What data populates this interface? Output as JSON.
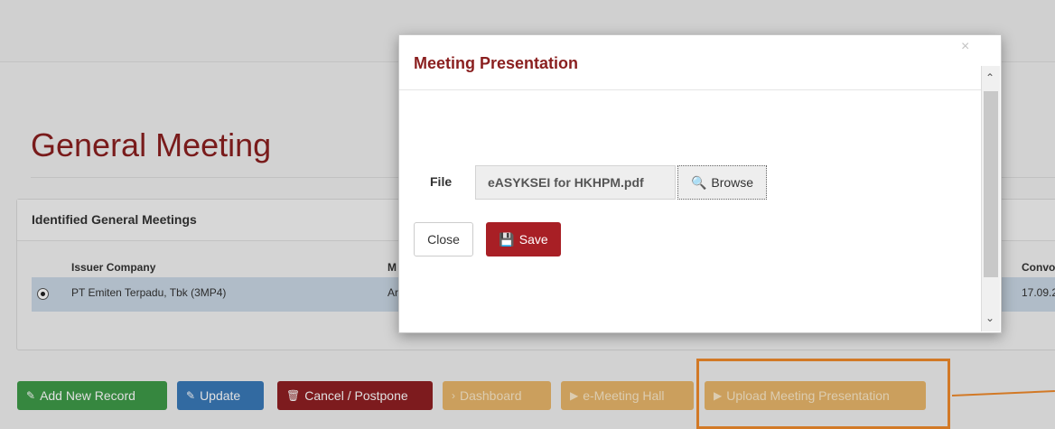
{
  "page": {
    "title": "General Meeting",
    "panel_title": "Identified General Meetings",
    "columns": [
      "Issuer Company",
      "M",
      "Convo"
    ],
    "row": {
      "issuer": "PT Emiten Terpadu, Tbk (3MP4)",
      "col2": "Ar",
      "col3": "17.09.2"
    }
  },
  "buttons": {
    "add": "Add New Record",
    "update": "Update",
    "cancel": "Cancel / Postpone",
    "dashboard": "Dashboard",
    "hall": "e-Meeting Hall",
    "upload": "Upload Meeting Presentation"
  },
  "modal": {
    "title": "Meeting Presentation",
    "close_glyph": "×",
    "file_label": "File",
    "file_value": "eASYKSEI for HKHPM.pdf",
    "browse": "Browse",
    "close": "Close",
    "save": "Save"
  },
  "icons": {
    "edit": "✎",
    "trash": "🗑",
    "chevron": "›",
    "play": "▶",
    "search": "🔍",
    "save": "💾",
    "up": "⌃",
    "down": "⌄"
  },
  "colors": {
    "brand": "#8a1f1f",
    "green": "#3e9a48",
    "blue": "#3a79b8",
    "dark_red": "#8f1f23",
    "orange": "#e7b66a",
    "highlight": "#f08a2c"
  }
}
